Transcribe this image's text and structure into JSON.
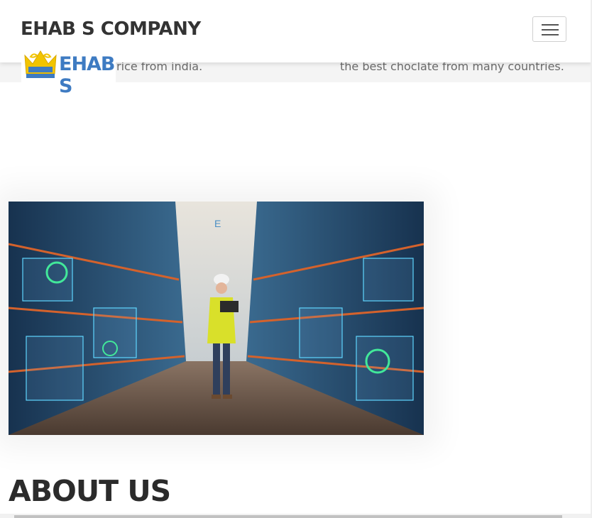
{
  "header": {
    "brand": "EHAB S COMPANY",
    "menu_icon": "hamburger-menu-icon"
  },
  "logo": {
    "text": "EHAB S",
    "icon": "crown-icon",
    "colors": {
      "crown": "#f2c400",
      "text": "#3e7bc2"
    }
  },
  "products_strip": {
    "left_text": "rice from india.",
    "right_text": "the best choclate from many countries."
  },
  "hero": {
    "image": "warehouse-worker-photo"
  },
  "about": {
    "title": "ABOUT US"
  },
  "colors": {
    "navbar_bg": "#ffffff",
    "band_bg": "#f4f4f4",
    "heading": "#2b2b2b"
  }
}
